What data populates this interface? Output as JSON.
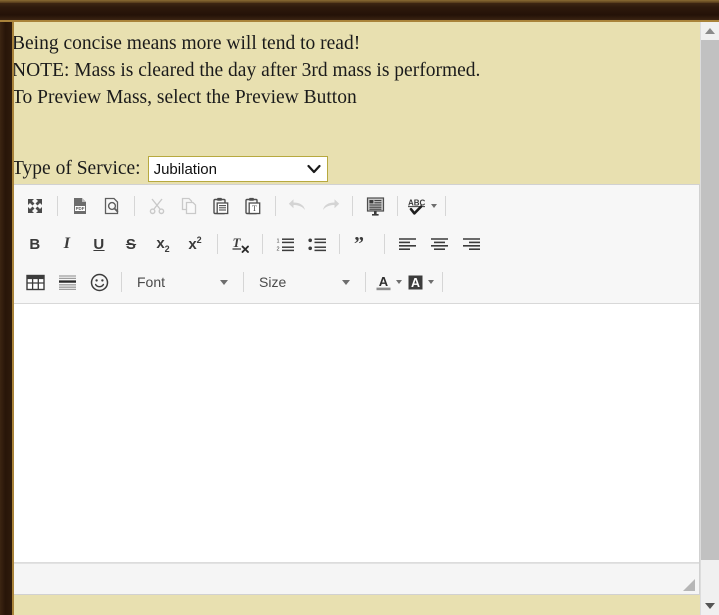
{
  "page": {
    "background_color": "#e8e0b0",
    "frame_color": "#2b1a0e",
    "frame_accent_color": "#a9833a"
  },
  "instructions": {
    "line1": "Being concise means more will tend to read!",
    "line2": "NOTE: Mass is cleared the day after 3rd mass is performed.",
    "line3": "To Preview Mass, select the Preview Button"
  },
  "service": {
    "label": "Type of Service:",
    "selected": "Jubilation",
    "options": [
      "Jubilation"
    ],
    "chevron_icon": "chevron-down-icon"
  },
  "editor": {
    "content": "",
    "placeholder": "",
    "toolbar": {
      "row1": [
        {
          "name": "maximize-button",
          "icon": "maximize-icon",
          "label": "Maximize",
          "disabled": false
        },
        {
          "name": "separator",
          "icon": "separator",
          "label": "",
          "disabled": false
        },
        {
          "name": "export-pdf-button",
          "icon": "pdf-icon",
          "label": "Export to PDF",
          "disabled": false
        },
        {
          "name": "preview-button",
          "icon": "preview-icon",
          "label": "Preview",
          "disabled": false
        },
        {
          "name": "separator",
          "icon": "separator",
          "label": "",
          "disabled": false
        },
        {
          "name": "cut-button",
          "icon": "scissors-icon",
          "label": "Cut",
          "disabled": true
        },
        {
          "name": "copy-button",
          "icon": "copy-icon",
          "label": "Copy",
          "disabled": true
        },
        {
          "name": "paste-button",
          "icon": "paste-icon",
          "label": "Paste",
          "disabled": false
        },
        {
          "name": "paste-as-text-button",
          "icon": "paste-text-icon",
          "label": "Paste as plain text",
          "disabled": false
        },
        {
          "name": "separator",
          "icon": "separator",
          "label": "",
          "disabled": false
        },
        {
          "name": "undo-button",
          "icon": "undo-arrow-icon",
          "label": "Undo",
          "disabled": true
        },
        {
          "name": "redo-button",
          "icon": "redo-arrow-icon",
          "label": "Redo",
          "disabled": true
        },
        {
          "name": "separator",
          "icon": "separator",
          "label": "",
          "disabled": false
        },
        {
          "name": "templates-button",
          "icon": "templates-icon",
          "label": "Templates",
          "disabled": false
        },
        {
          "name": "separator",
          "icon": "separator",
          "label": "",
          "disabled": false
        },
        {
          "name": "spellcheck-button",
          "icon": "spellcheck-abc-icon",
          "label": "Check Spelling",
          "disabled": false,
          "dropdown": true
        },
        {
          "name": "separator",
          "icon": "separator",
          "label": "",
          "disabled": false
        }
      ],
      "row2": [
        {
          "name": "bold-button",
          "icon": "bold-icon",
          "label": "B",
          "disabled": false
        },
        {
          "name": "italic-button",
          "icon": "italic-icon",
          "label": "I",
          "disabled": false
        },
        {
          "name": "underline-button",
          "icon": "underline-icon",
          "label": "U",
          "disabled": false
        },
        {
          "name": "strikethrough-button",
          "icon": "strikethrough-icon",
          "label": "S",
          "disabled": false
        },
        {
          "name": "subscript-button",
          "icon": "subscript-icon",
          "label": "x",
          "disabled": false
        },
        {
          "name": "superscript-button",
          "icon": "superscript-icon",
          "label": "x",
          "disabled": false
        },
        {
          "name": "separator",
          "icon": "separator",
          "label": "",
          "disabled": false
        },
        {
          "name": "remove-format-button",
          "icon": "remove-format-icon",
          "label": "Remove Format",
          "disabled": false
        },
        {
          "name": "separator",
          "icon": "separator",
          "label": "",
          "disabled": false
        },
        {
          "name": "numbered-list-button",
          "icon": "numbered-list-icon",
          "label": "Insert/Remove Numbered List",
          "disabled": false
        },
        {
          "name": "bulleted-list-button",
          "icon": "bulleted-list-icon",
          "label": "Insert/Remove Bulleted List",
          "disabled": false
        },
        {
          "name": "separator",
          "icon": "separator",
          "label": "",
          "disabled": false
        },
        {
          "name": "blockquote-button",
          "icon": "blockquote-icon",
          "label": "Block Quote",
          "disabled": false
        },
        {
          "name": "separator",
          "icon": "separator",
          "label": "",
          "disabled": false
        },
        {
          "name": "align-left-button",
          "icon": "align-left-icon",
          "label": "Align Left",
          "disabled": false
        },
        {
          "name": "align-center-button",
          "icon": "align-center-icon",
          "label": "Center",
          "disabled": false
        },
        {
          "name": "align-right-button",
          "icon": "align-right-icon",
          "label": "Align Right",
          "disabled": false
        }
      ],
      "row3": [
        {
          "name": "table-button",
          "icon": "table-icon",
          "label": "Table",
          "disabled": false
        },
        {
          "name": "horizontal-rule-button",
          "icon": "horizontal-rule-icon",
          "label": "Insert Horizontal Line",
          "disabled": false
        },
        {
          "name": "smiley-button",
          "icon": "smiley-icon",
          "label": "Insert Smiley",
          "disabled": false
        },
        {
          "name": "separator",
          "icon": "separator",
          "label": "",
          "disabled": false
        }
      ],
      "font_combo": {
        "label": "Font",
        "arrow_icon": "chevron-down-icon"
      },
      "size_combo": {
        "label": "Size",
        "arrow_icon": "chevron-down-icon"
      },
      "text_color_button": {
        "label": "A",
        "icon": "text-color-icon",
        "arrow_icon": "chevron-down-icon"
      },
      "bg_color_button": {
        "label": "A",
        "icon": "background-color-icon",
        "arrow_icon": "chevron-down-icon"
      }
    },
    "status_bar": {
      "text": "",
      "resize_icon": "resize-grip-icon"
    }
  },
  "scrollbar": {
    "up_arrow_icon": "triangle-up-icon",
    "down_arrow_icon": "triangle-down-icon",
    "thumb_name": "scrollbar-thumb"
  }
}
